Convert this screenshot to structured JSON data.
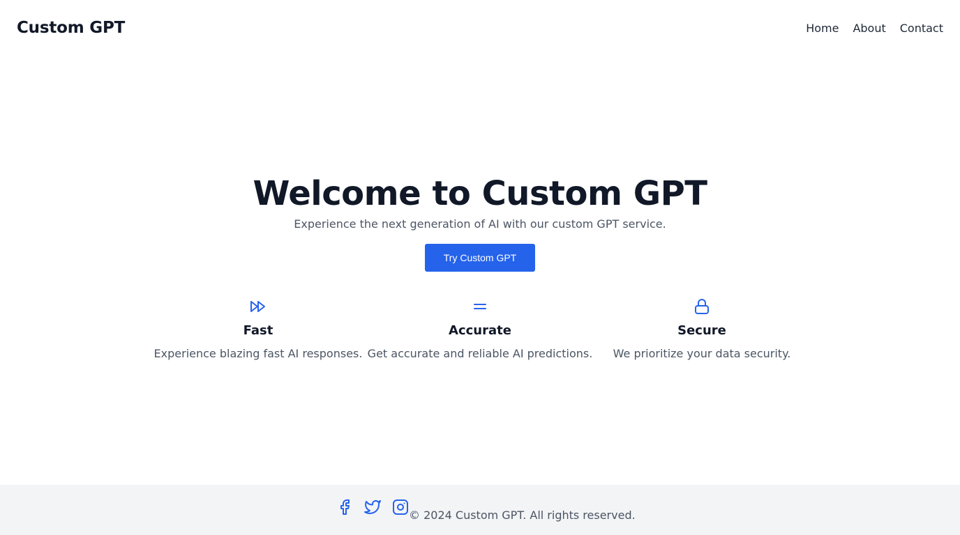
{
  "header": {
    "brand": "Custom GPT",
    "nav": [
      {
        "label": "Home"
      },
      {
        "label": "About"
      },
      {
        "label": "Contact"
      }
    ]
  },
  "hero": {
    "title": "Welcome to Custom GPT",
    "subtitle": "Experience the next generation of AI with our custom GPT service.",
    "cta_label": "Try Custom GPT"
  },
  "features": [
    {
      "icon": "fast-forward-icon",
      "title": "Fast",
      "description": "Experience blazing fast AI responses."
    },
    {
      "icon": "equals-icon",
      "title": "Accurate",
      "description": "Get accurate and reliable AI predictions."
    },
    {
      "icon": "lock-icon",
      "title": "Secure",
      "description": "We prioritize your data security."
    }
  ],
  "footer": {
    "social": [
      {
        "icon": "facebook-icon"
      },
      {
        "icon": "twitter-icon"
      },
      {
        "icon": "instagram-icon"
      }
    ],
    "copyright": "© 2024 Custom GPT. All rights reserved."
  },
  "colors": {
    "accent": "#2563eb",
    "footer_bg": "#f3f4f6",
    "text_primary": "#111827",
    "text_secondary": "#4b5563"
  }
}
